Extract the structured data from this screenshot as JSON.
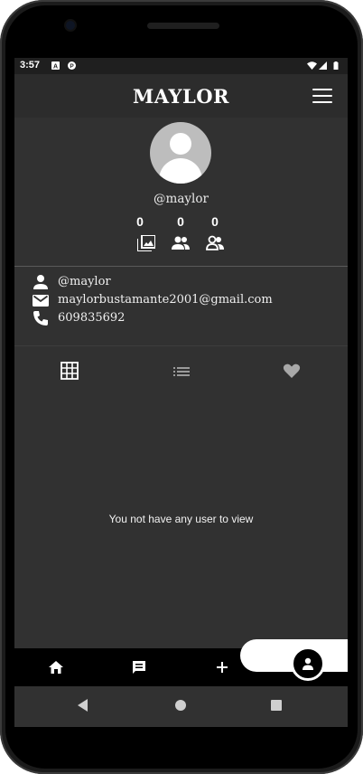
{
  "status_bar": {
    "time": "3:57",
    "icons": [
      "notification-a-icon",
      "notification-p-icon",
      "wifi-icon",
      "signal-icon",
      "battery-icon"
    ]
  },
  "app_bar": {
    "title": "MAYLOR",
    "menu_icon": "hamburger-menu-icon"
  },
  "profile": {
    "handle": "@maylor",
    "stats": [
      {
        "count": "0",
        "icon": "photo-library-icon"
      },
      {
        "count": "0",
        "icon": "followers-icon"
      },
      {
        "count": "0",
        "icon": "following-icon"
      }
    ]
  },
  "info": {
    "username": "@maylor",
    "email": "maylorbustamante2001@gmail.com",
    "phone": "609835692"
  },
  "tabs": [
    {
      "icon": "grid-icon"
    },
    {
      "icon": "list-icon"
    },
    {
      "icon": "heart-icon"
    }
  ],
  "empty_message": "You not have any user to view",
  "bottom_nav": [
    "home-icon",
    "chat-icon",
    "add-icon",
    "profile-icon"
  ],
  "colors": {
    "screen_bg": "#313131",
    "app_bar_bg": "#2c2c2c",
    "avatar_bg": "#bdbdbd",
    "bottom_bar_bg": "#000000"
  }
}
